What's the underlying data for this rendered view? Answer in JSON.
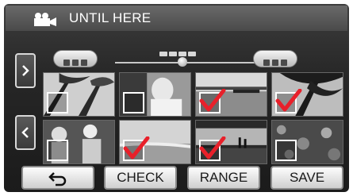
{
  "header": {
    "title": "UNTIL HERE",
    "icon": "movie-camera-icon"
  },
  "nav": {
    "next_icon": "chevron-right-icon",
    "prev_icon": "chevron-left-icon"
  },
  "thumbnails": [
    {
      "scene": "palm-trees",
      "checked": false
    },
    {
      "scene": "person-portrait",
      "checked": false
    },
    {
      "scene": "boat-on-water",
      "checked": true
    },
    {
      "scene": "palm-silhouette",
      "checked": true
    },
    {
      "scene": "dancing-people",
      "checked": false
    },
    {
      "scene": "beach-shore",
      "checked": true
    },
    {
      "scene": "sunset-people",
      "checked": true
    },
    {
      "scene": "leaves-texture",
      "checked": false
    }
  ],
  "buttons": {
    "back_icon": "back-arrow-icon",
    "check": "CHECK",
    "range": "RANGE",
    "save": "SAVE"
  },
  "colors": {
    "checkmark": "#e8202a",
    "background": "#262626"
  }
}
